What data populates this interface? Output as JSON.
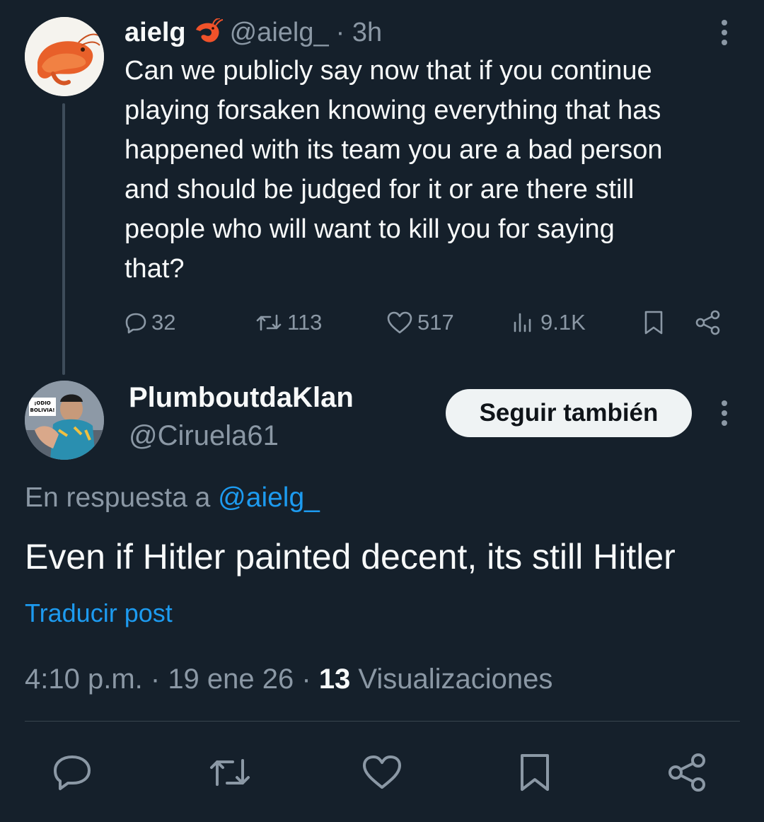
{
  "parent_tweet": {
    "display_name": "aielg",
    "name_emoji": "shrimp-emoji",
    "handle": "@aielg_",
    "time_ago": "· 3h",
    "text": "Can we publicly say now that if you continue\nplaying forsaken knowing everything that has\nhappened with its team you are a bad person\nand should be judged for it or are there still\npeople who will want to kill you for saying\nthat?",
    "stats": {
      "replies": "32",
      "reposts": "113",
      "likes": "517",
      "views": "9.1K"
    }
  },
  "reply_tweet": {
    "display_name": "PlumboutdaKlan",
    "handle": "@Ciruela61",
    "follow_label": "Seguir también",
    "avatar_sign_text": "¡ODIO BOLIVIA!",
    "reply_prefix": "En respuesta a ",
    "reply_to_handle": "@aielg_",
    "text": "Even if Hitler painted decent, its still Hitler",
    "translate_label": "Traducir post",
    "time": "4:10 p.m.",
    "sep1": " · ",
    "date": "19 ene 26",
    "sep2": " · ",
    "views_count": "13",
    "views_label": " Visualizaciones"
  },
  "colors": {
    "background": "#15202b",
    "text": "#f7f9f9",
    "muted": "#8b98a5",
    "link": "#1d9bf0",
    "thread_line": "#3e4c5a",
    "divider": "#38444d"
  }
}
